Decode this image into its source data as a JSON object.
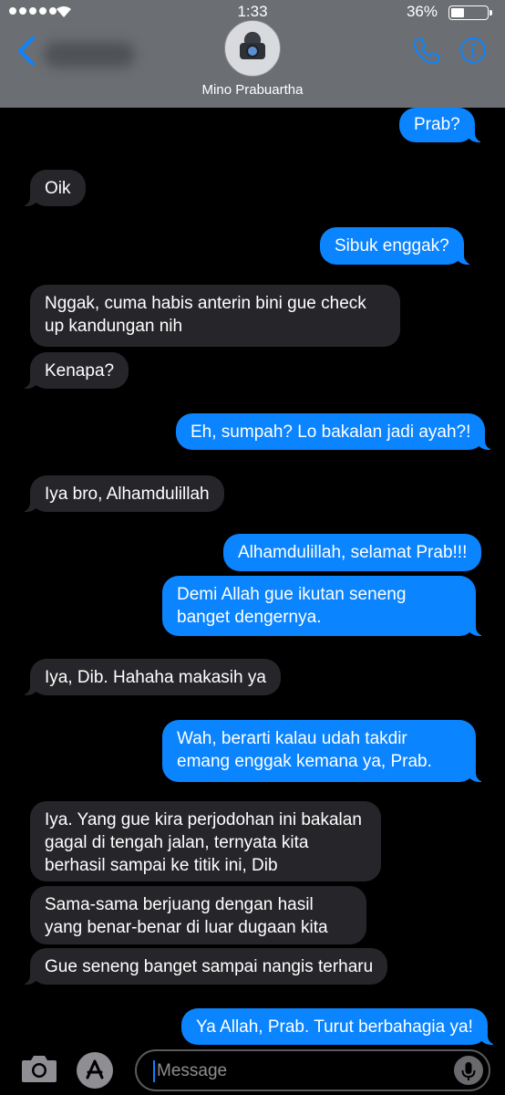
{
  "status_bar": {
    "time": "1:33",
    "battery": "36%"
  },
  "header": {
    "contact_name": "Mino Prabuartha"
  },
  "messages": [
    {
      "text": "Prab?"
    },
    {
      "text": "Oik"
    },
    {
      "text": "Sibuk enggak?"
    },
    {
      "text": "Nggak, cuma habis anterin bini gue check up kandungan nih"
    },
    {
      "text": "Kenapa?"
    },
    {
      "text": "Eh, sumpah? Lo bakalan jadi ayah?!"
    },
    {
      "text": "Iya bro, Alhamdulillah"
    },
    {
      "text": "Alhamdulillah, selamat Prab!!!"
    },
    {
      "text": "Demi Allah gue ikutan seneng banget dengernya."
    },
    {
      "text": "Iya, Dib. Hahaha makasih ya"
    },
    {
      "text": "Wah, berarti kalau udah takdir emang enggak kemana ya, Prab."
    },
    {
      "text": "Iya. Yang gue kira perjodohan ini bakalan gagal di tengah jalan, ternyata kita berhasil sampai ke titik ini, Dib"
    },
    {
      "text": "Sama-sama berjuang dengan hasil yang benar-benar di luar dugaan kita"
    },
    {
      "text": "Gue seneng banget sampai nangis terharu"
    },
    {
      "text": "Ya Allah, Prab. Turut berbahagia ya!"
    }
  ],
  "input": {
    "placeholder": "Message"
  },
  "icons": {
    "back": "chevron-left-icon",
    "phone": "phone-icon",
    "info": "info-icon",
    "camera": "camera-icon",
    "apps": "app-store-icon",
    "mic": "microphone-icon"
  },
  "colors": {
    "outgoing": "#0a84ff",
    "incoming": "#26262a",
    "header": "#6b6e72"
  }
}
